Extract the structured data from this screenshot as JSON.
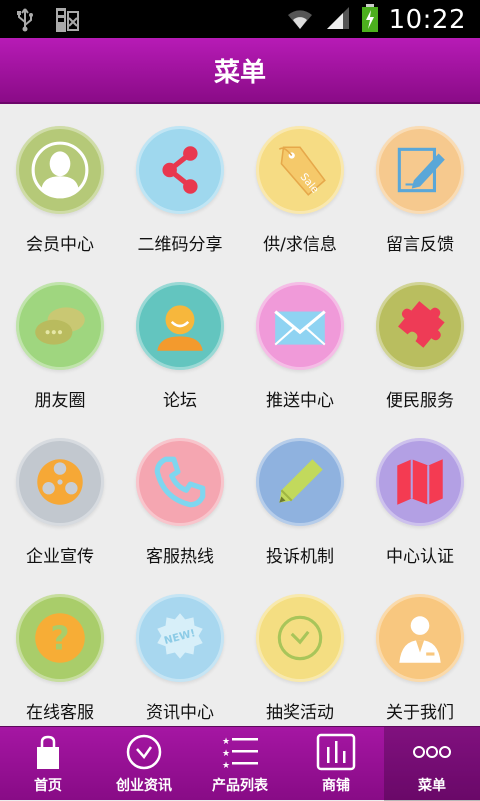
{
  "status": {
    "time": "10:22"
  },
  "header": {
    "title": "菜单"
  },
  "menu": [
    {
      "label": "会员中心",
      "icon": "user-icon",
      "color": "#b5c978"
    },
    {
      "label": "二维码分享",
      "icon": "share-icon",
      "color": "#9fd8ee"
    },
    {
      "label": "供/求信息",
      "icon": "sale-tag-icon",
      "color": "#f6dc84"
    },
    {
      "label": "留言反馈",
      "icon": "edit-note-icon",
      "color": "#f6c98e"
    },
    {
      "label": "朋友圈",
      "icon": "chat-bubbles-icon",
      "color": "#9fd67f"
    },
    {
      "label": "论坛",
      "icon": "person-chat-icon",
      "color": "#63c5bf"
    },
    {
      "label": "推送中心",
      "icon": "envelope-icon",
      "color": "#f09ad9"
    },
    {
      "label": "便民服务",
      "icon": "puzzle-icon",
      "color": "#b9be5f"
    },
    {
      "label": "企业宣传",
      "icon": "film-reel-icon",
      "color": "#c2c8cf"
    },
    {
      "label": "客服热线",
      "icon": "phone-icon",
      "color": "#f5a6b1"
    },
    {
      "label": "投诉机制",
      "icon": "pencil-icon",
      "color": "#8fb2df"
    },
    {
      "label": "中心认证",
      "icon": "map-icon",
      "color": "#b3a0e4"
    },
    {
      "label": "在线客服",
      "icon": "help-icon",
      "color": "#a9cd6a"
    },
    {
      "label": "资讯中心",
      "icon": "news-badge-icon",
      "color": "#a8d7ef"
    },
    {
      "label": "抽奖活动",
      "icon": "clock-icon",
      "color": "#f4de82"
    },
    {
      "label": "关于我们",
      "icon": "businessman-icon",
      "color": "#f8c77f"
    }
  ],
  "tabs": [
    {
      "label": "首页",
      "icon": "shopping-bag-icon"
    },
    {
      "label": "创业资讯",
      "icon": "clock-icon"
    },
    {
      "label": "产品列表",
      "icon": "list-icon"
    },
    {
      "label": "商铺",
      "icon": "bar-chart-icon"
    },
    {
      "label": "菜单",
      "icon": "more-dots-icon"
    }
  ]
}
